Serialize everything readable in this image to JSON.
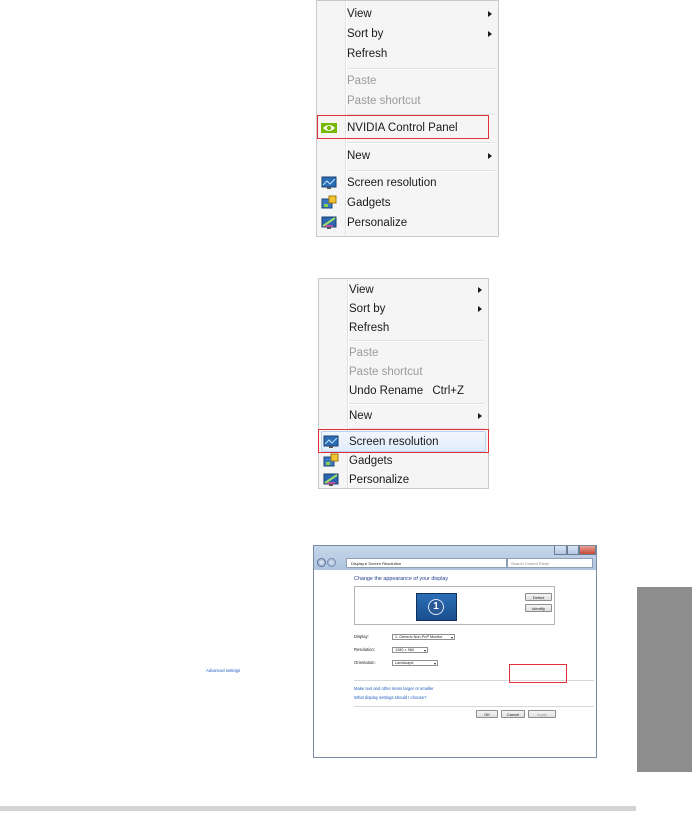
{
  "menu1": {
    "items": [
      {
        "label": "View",
        "submenu": true,
        "disabled": false
      },
      {
        "label": "Sort by",
        "submenu": true,
        "disabled": false
      },
      {
        "label": "Refresh",
        "submenu": false,
        "disabled": false
      },
      {
        "label": "Paste",
        "submenu": false,
        "disabled": true
      },
      {
        "label": "Paste shortcut",
        "submenu": false,
        "disabled": true
      },
      {
        "label": "NVIDIA Control Panel",
        "submenu": false,
        "disabled": false,
        "icon": "nvidia-icon",
        "highlighted": true
      },
      {
        "label": "New",
        "submenu": true,
        "disabled": false
      },
      {
        "label": "Screen resolution",
        "submenu": false,
        "disabled": false,
        "icon": "screen-resolution-icon"
      },
      {
        "label": "Gadgets",
        "submenu": false,
        "disabled": false,
        "icon": "gadgets-icon"
      },
      {
        "label": "Personalize",
        "submenu": false,
        "disabled": false,
        "icon": "personalize-icon"
      }
    ]
  },
  "menu2": {
    "items": [
      {
        "label": "View",
        "submenu": true,
        "disabled": false
      },
      {
        "label": "Sort by",
        "submenu": true,
        "disabled": false
      },
      {
        "label": "Refresh",
        "submenu": false,
        "disabled": false
      },
      {
        "label": "Paste",
        "submenu": false,
        "disabled": true
      },
      {
        "label": "Paste shortcut",
        "submenu": false,
        "disabled": true
      },
      {
        "label": "Undo Rename",
        "shortcut": "Ctrl+Z",
        "submenu": false,
        "disabled": false
      },
      {
        "label": "New",
        "submenu": true,
        "disabled": false
      },
      {
        "label": "Screen resolution",
        "submenu": false,
        "disabled": false,
        "icon": "screen-resolution-icon",
        "highlighted": true
      },
      {
        "label": "Gadgets",
        "submenu": false,
        "disabled": false,
        "icon": "gadgets-icon"
      },
      {
        "label": "Personalize",
        "submenu": false,
        "disabled": false,
        "icon": "personalize-icon"
      }
    ]
  },
  "window": {
    "breadcrumb_1": "Display",
    "breadcrumb_2": "Screen Resolution",
    "search_placeholder": "Search Control Panel",
    "heading": "Change the appearance of your display",
    "detect_label": "Detect",
    "identify_label": "Identify",
    "monitor_number": "1",
    "display_label": "Display:",
    "display_value": "1. Generic Non-PnP Monitor",
    "resolution_label": "Resolution:",
    "resolution_value": "1280 × 960",
    "orientation_label": "Orientation:",
    "orientation_value": "Landscape",
    "advanced_link": "Advanced settings",
    "link_text_size": "Make text and other items larger or smaller",
    "link_display_settings": "What display settings should I choose?",
    "ok_label": "OK",
    "cancel_label": "Cancel",
    "apply_label": "Apply"
  },
  "colors": {
    "highlight_border": "#e0303a",
    "link": "#1f5cc0",
    "side_tab": "#8d8d8d"
  }
}
